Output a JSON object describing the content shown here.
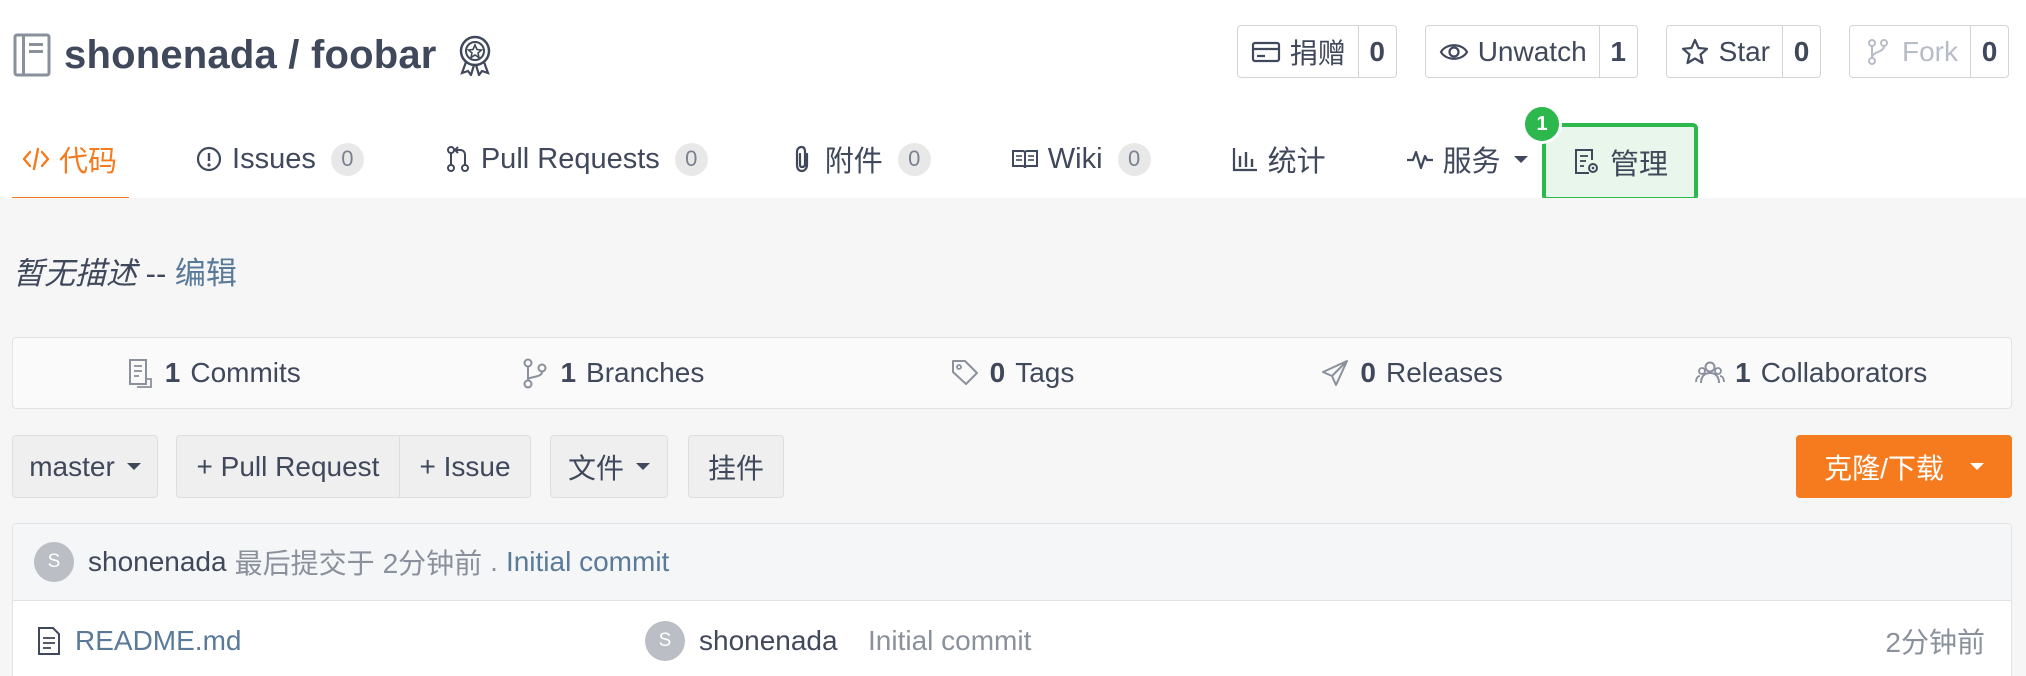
{
  "repo": {
    "owner": "shonenada",
    "separator": "/",
    "name": "foobar"
  },
  "actions": [
    {
      "label": "捐赠",
      "count": "0",
      "icon": "donate-icon"
    },
    {
      "label": "Unwatch",
      "count": "1",
      "icon": "eye-icon"
    },
    {
      "label": "Star",
      "count": "0",
      "icon": "star-icon"
    },
    {
      "label": "Fork",
      "count": "0",
      "icon": "fork-icon"
    }
  ],
  "tabs": {
    "code": "代码",
    "issues": {
      "label": "Issues",
      "count": "0"
    },
    "pulls": {
      "label": "Pull Requests",
      "count": "0"
    },
    "attachments": {
      "label": "附件",
      "count": "0"
    },
    "wiki": {
      "label": "Wiki",
      "count": "0"
    },
    "stats": "统计",
    "services": "服务",
    "manage": "管理",
    "step_badge": "1"
  },
  "description": {
    "text": "暂无描述",
    "separator": "--",
    "edit": "编辑"
  },
  "stats": [
    {
      "count": "1",
      "label": "Commits"
    },
    {
      "count": "1",
      "label": "Branches"
    },
    {
      "count": "0",
      "label": "Tags"
    },
    {
      "count": "0",
      "label": "Releases"
    },
    {
      "count": "1",
      "label": "Collaborators"
    }
  ],
  "toolbar": {
    "branch": "master",
    "pull_request": "+ Pull Request",
    "issue": "+ Issue",
    "files": "文件",
    "widgets": "挂件",
    "clone": "克隆/下载"
  },
  "latest_commit": {
    "avatar_letter": "S",
    "author": "shonenada",
    "prefix": "最后提交于",
    "time": "2分钟前",
    "dot": ".",
    "message": "Initial commit"
  },
  "files": [
    {
      "name": "README.md",
      "avatar_letter": "S",
      "author": "shonenada",
      "message": "Initial commit",
      "time": "2分钟前"
    }
  ],
  "colors": {
    "accent": "#f67b1e",
    "highlight": "#2db84d",
    "text": "#40485b",
    "link": "#5a7a99"
  }
}
